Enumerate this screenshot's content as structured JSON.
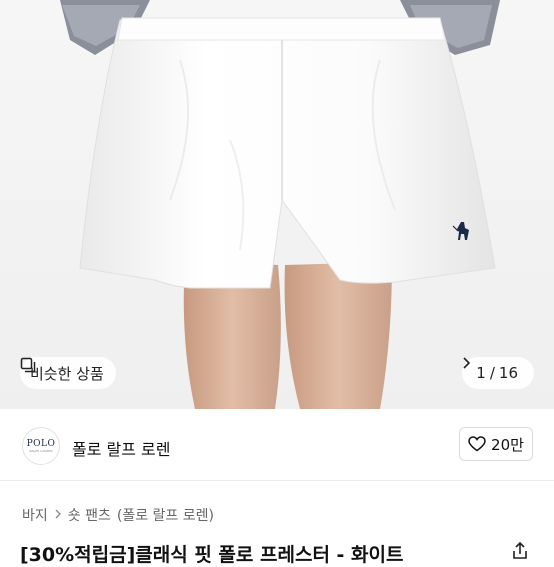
{
  "gallery": {
    "similar_label": "비슷한 상품",
    "current_index": "1",
    "counter_sep": "/",
    "total": "16",
    "colors": {
      "shorts": "#ffffff",
      "skin": "#d9b29a",
      "logo_mark": "#1a2a4a"
    }
  },
  "shop": {
    "logo_text": "POLO",
    "logo_subtext": "RALPH LAUREN",
    "name": "폴로 랄프 로렌",
    "like_count": "20만"
  },
  "breadcrumb": {
    "items": [
      "바지",
      "숏 팬츠",
      "(폴로 랄프 로렌)"
    ]
  },
  "product": {
    "title": "[30%적립금]클래식 핏 폴로 프레스터 - 화이트"
  },
  "icons": {
    "similar": "stacked-squares-icon",
    "next": "chevron-right-icon",
    "like": "heart-icon",
    "share": "share-icon"
  }
}
